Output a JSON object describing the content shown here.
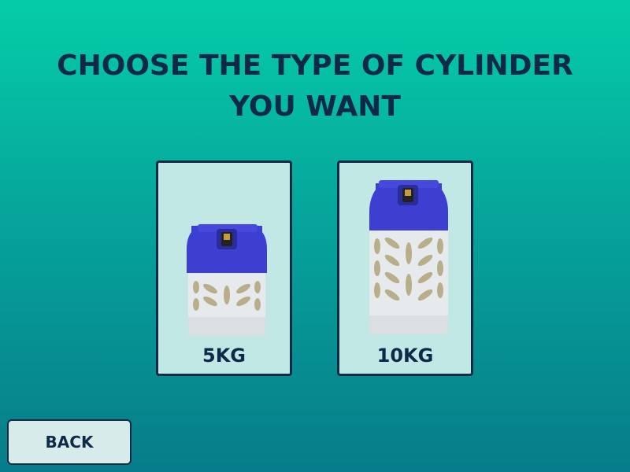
{
  "title": {
    "line1": "CHOOSE THE TYPE OF CYLINDER",
    "line2": "YOU WANT"
  },
  "options": [
    {
      "label": "5KG",
      "icon": "gas-cylinder-icon"
    },
    {
      "label": "10KG",
      "icon": "gas-cylinder-icon"
    }
  ],
  "back": {
    "label": "BACK"
  },
  "colors": {
    "text": "#0e2a48",
    "card_bg": "#c2e8e6",
    "card_border": "#0d2c44",
    "cylinder_top": "#3c3fd0",
    "cylinder_body": "#e9ecef"
  }
}
